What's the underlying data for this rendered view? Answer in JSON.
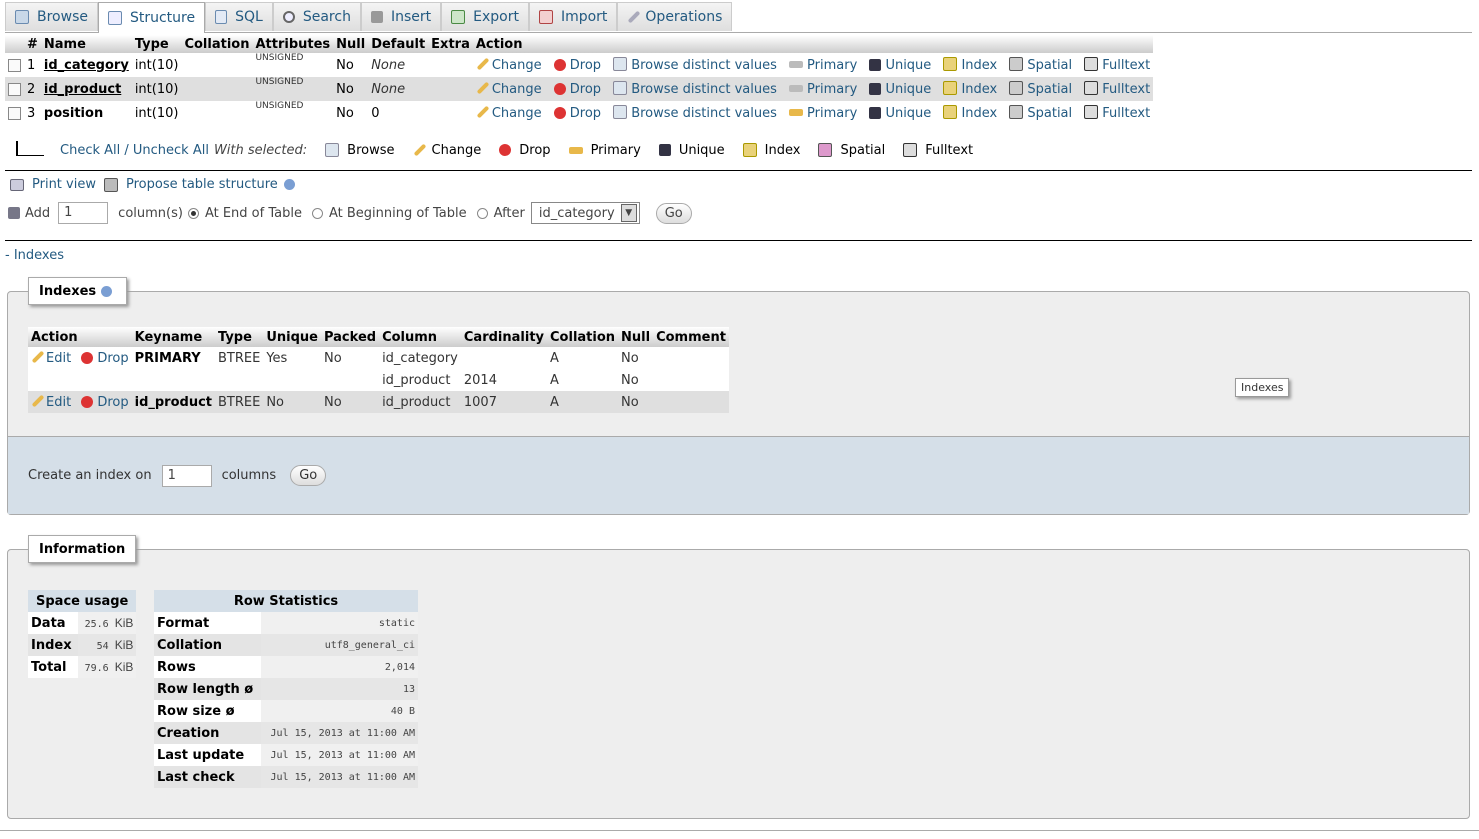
{
  "tabs": [
    {
      "label": "Browse",
      "icon": "browse-icon"
    },
    {
      "label": "Structure",
      "icon": "structure-icon",
      "active": true
    },
    {
      "label": "SQL",
      "icon": "sql-icon"
    },
    {
      "label": "Search",
      "icon": "search-icon"
    },
    {
      "label": "Insert",
      "icon": "insert-icon"
    },
    {
      "label": "Export",
      "icon": "export-icon"
    },
    {
      "label": "Import",
      "icon": "import-icon"
    },
    {
      "label": "Operations",
      "icon": "operations-icon"
    }
  ],
  "structure": {
    "headers": [
      "#",
      "Name",
      "Type",
      "Collation",
      "Attributes",
      "Null",
      "Default",
      "Extra",
      "Action"
    ],
    "rows": [
      {
        "num": "1",
        "name": "id_category",
        "type": "int(10)",
        "attributes": "UNSIGNED",
        "null": "No",
        "default": "None"
      },
      {
        "num": "2",
        "name": "id_product",
        "type": "int(10)",
        "attributes": "UNSIGNED",
        "null": "No",
        "default": "None"
      },
      {
        "num": "3",
        "name": "position",
        "type": "int(10)",
        "attributes": "UNSIGNED",
        "null": "No",
        "default": "0"
      }
    ],
    "row_actions": {
      "change": "Change",
      "drop": "Drop",
      "browse_distinct": "Browse distinct values",
      "primary": "Primary",
      "unique": "Unique",
      "index": "Index",
      "spatial": "Spatial",
      "fulltext": "Fulltext"
    }
  },
  "with_selected": {
    "check_all": "Check All / Uncheck All",
    "label": "With selected:",
    "actions": [
      "Browse",
      "Change",
      "Drop",
      "Primary",
      "Unique",
      "Index",
      "Spatial",
      "Fulltext"
    ]
  },
  "print_view": "Print view",
  "propose": "Propose table structure",
  "add_column": {
    "add_label": "Add",
    "count": "1",
    "columns_label": "column(s)",
    "at_end": "At End of Table",
    "at_beginning": "At Beginning of Table",
    "after": "After",
    "after_value": "id_category",
    "go": "Go"
  },
  "indexes_toggle": "- Indexes",
  "indexes": {
    "legend": "Indexes",
    "headers": [
      "Action",
      "Keyname",
      "Type",
      "Unique",
      "Packed",
      "Column",
      "Cardinality",
      "Collation",
      "Null",
      "Comment"
    ],
    "edit": "Edit",
    "drop": "Drop",
    "rows": [
      {
        "keyname": "PRIMARY",
        "type": "BTREE",
        "unique": "Yes",
        "packed": "No",
        "column": "id_category",
        "cardinality": "",
        "collation": "A",
        "null": "No"
      },
      {
        "keyname": "",
        "type": "",
        "unique": "",
        "packed": "",
        "column": "id_product",
        "cardinality": "2014",
        "collation": "A",
        "null": "No"
      },
      {
        "keyname": "id_product",
        "type": "BTREE",
        "unique": "No",
        "packed": "No",
        "column": "id_product",
        "cardinality": "1007",
        "collation": "A",
        "null": "No"
      }
    ],
    "create_label": "Create an index on",
    "create_count": "1",
    "columns": "columns",
    "go": "Go",
    "tooltip": "Indexes"
  },
  "information": {
    "legend": "Information",
    "space_usage": {
      "title": "Space usage",
      "rows": [
        {
          "label": "Data",
          "value": "25.6",
          "unit": "KiB"
        },
        {
          "label": "Index",
          "value": "54",
          "unit": "KiB"
        },
        {
          "label": "Total",
          "value": "79.6",
          "unit": "KiB"
        }
      ]
    },
    "row_stats": {
      "title": "Row Statistics",
      "rows": [
        {
          "label": "Format",
          "value": "static"
        },
        {
          "label": "Collation",
          "value": "utf8_general_ci"
        },
        {
          "label": "Rows",
          "value": "2,014"
        },
        {
          "label": "Row length ø",
          "value": "13"
        },
        {
          "label": "Row size ø",
          "value": "40 B"
        },
        {
          "label": "Creation",
          "value": "Jul 15, 2013 at 11:00 AM"
        },
        {
          "label": "Last update",
          "value": "Jul 15, 2013 at 11:00 AM"
        },
        {
          "label": "Last check",
          "value": "Jul 15, 2013 at 11:00 AM"
        }
      ]
    }
  }
}
